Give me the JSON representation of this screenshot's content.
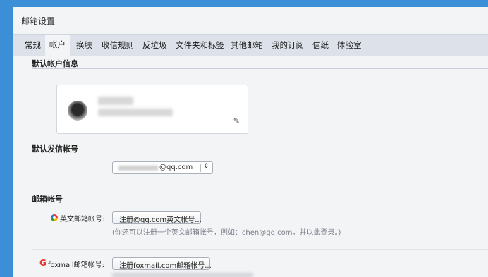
{
  "window": {
    "title": "邮箱设置"
  },
  "tabs": [
    {
      "label": "常规"
    },
    {
      "label": "帐户"
    },
    {
      "label": "换肤"
    },
    {
      "label": "收信规则"
    },
    {
      "label": "反垃圾"
    },
    {
      "label": "文件夹和标签"
    },
    {
      "label": "其他邮箱"
    },
    {
      "label": "我的订阅"
    },
    {
      "label": "信纸"
    },
    {
      "label": "体验室"
    }
  ],
  "active_tab": "帐户",
  "default_account": {
    "title": "默认帐户信息",
    "edit_icon": "pencil-icon"
  },
  "default_sender": {
    "title": "默认发信帐号",
    "selected_value": "@qq.com"
  },
  "mailbox_accounts": {
    "title": "邮箱帐号",
    "english": {
      "label": "英文邮箱帐号:",
      "button": "注册@qq.com英文帐号...",
      "hint": "(你还可以注册一个英文邮箱帐号，例如：chen@qq.com，并以此登录。)"
    },
    "foxmail": {
      "label": "foxmail邮箱帐号:",
      "button": "注册foxmail.com邮箱帐号..."
    }
  }
}
